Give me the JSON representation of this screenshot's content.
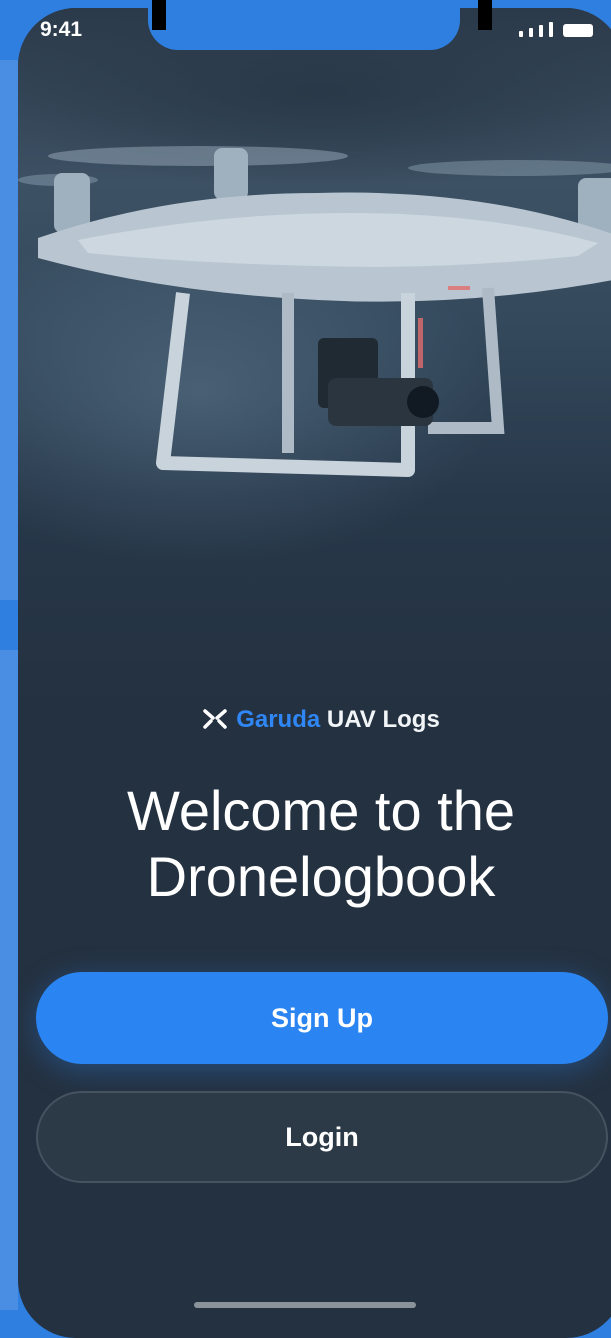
{
  "status_bar": {
    "time": "9:41"
  },
  "brand": {
    "accent": "Garuda",
    "rest": "UAV Logs",
    "icon": "x-logo-icon"
  },
  "welcome": {
    "line1": "Welcome to the",
    "line2": "Dronelogbook"
  },
  "buttons": {
    "signup": "Sign Up",
    "login": "Login"
  },
  "colors": {
    "accent": "#2a85f2",
    "background": "#243140",
    "frame": "#2f7fe0"
  }
}
